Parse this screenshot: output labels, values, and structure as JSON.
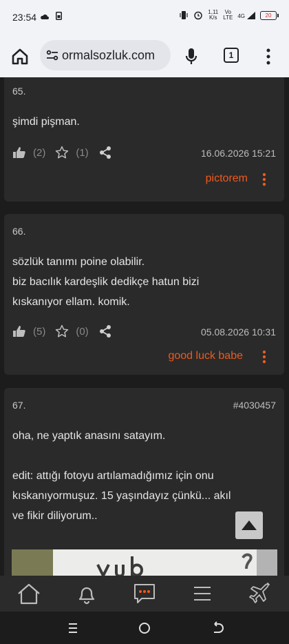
{
  "status_bar": {
    "time": "23:54",
    "net_speed_value": "1,11",
    "net_speed_unit": "K/s",
    "volte_top": "Vo",
    "volte_bottom": "LTE",
    "signal_label": "4G",
    "battery_level": "20"
  },
  "browser": {
    "url_text": "ormalsozluk.com",
    "tab_count": "1"
  },
  "entries": [
    {
      "number": "65.",
      "text_lines": [
        "şimdi pişman."
      ],
      "likes": "(2)",
      "favorites": "(1)",
      "date": "16.06.2026 15:21",
      "author": "pictorem"
    },
    {
      "number": "66.",
      "text_lines": [
        "sözlük tanımı poine olabilir.",
        "biz bacılık kardeşlik dedikçe hatun bizi",
        "kıskanıyor ellam. komik."
      ],
      "likes": "(5)",
      "favorites": "(0)",
      "date": "05.08.2026 10:31",
      "author": "good luck babe"
    },
    {
      "number": "67.",
      "entry_id": "#4030457",
      "text_lines": [
        "oha, ne yaptık anasını satayım.",
        "",
        "edit: attığı fotoyu artılamadığımız için onu",
        "kıskanıyormuşuz. 15 yaşındayız çünkü... akıl",
        "ve fikir diliyorum.."
      ]
    }
  ],
  "bottom_nav": [
    "home-icon",
    "bell-icon",
    "messages-icon",
    "menu-icon",
    "plane-icon"
  ],
  "colors": {
    "accent": "#ef5a1e",
    "card_bg": "#2a2a2a",
    "page_bg": "#1c1c1c",
    "browser_bar": "#f2f3f7"
  }
}
